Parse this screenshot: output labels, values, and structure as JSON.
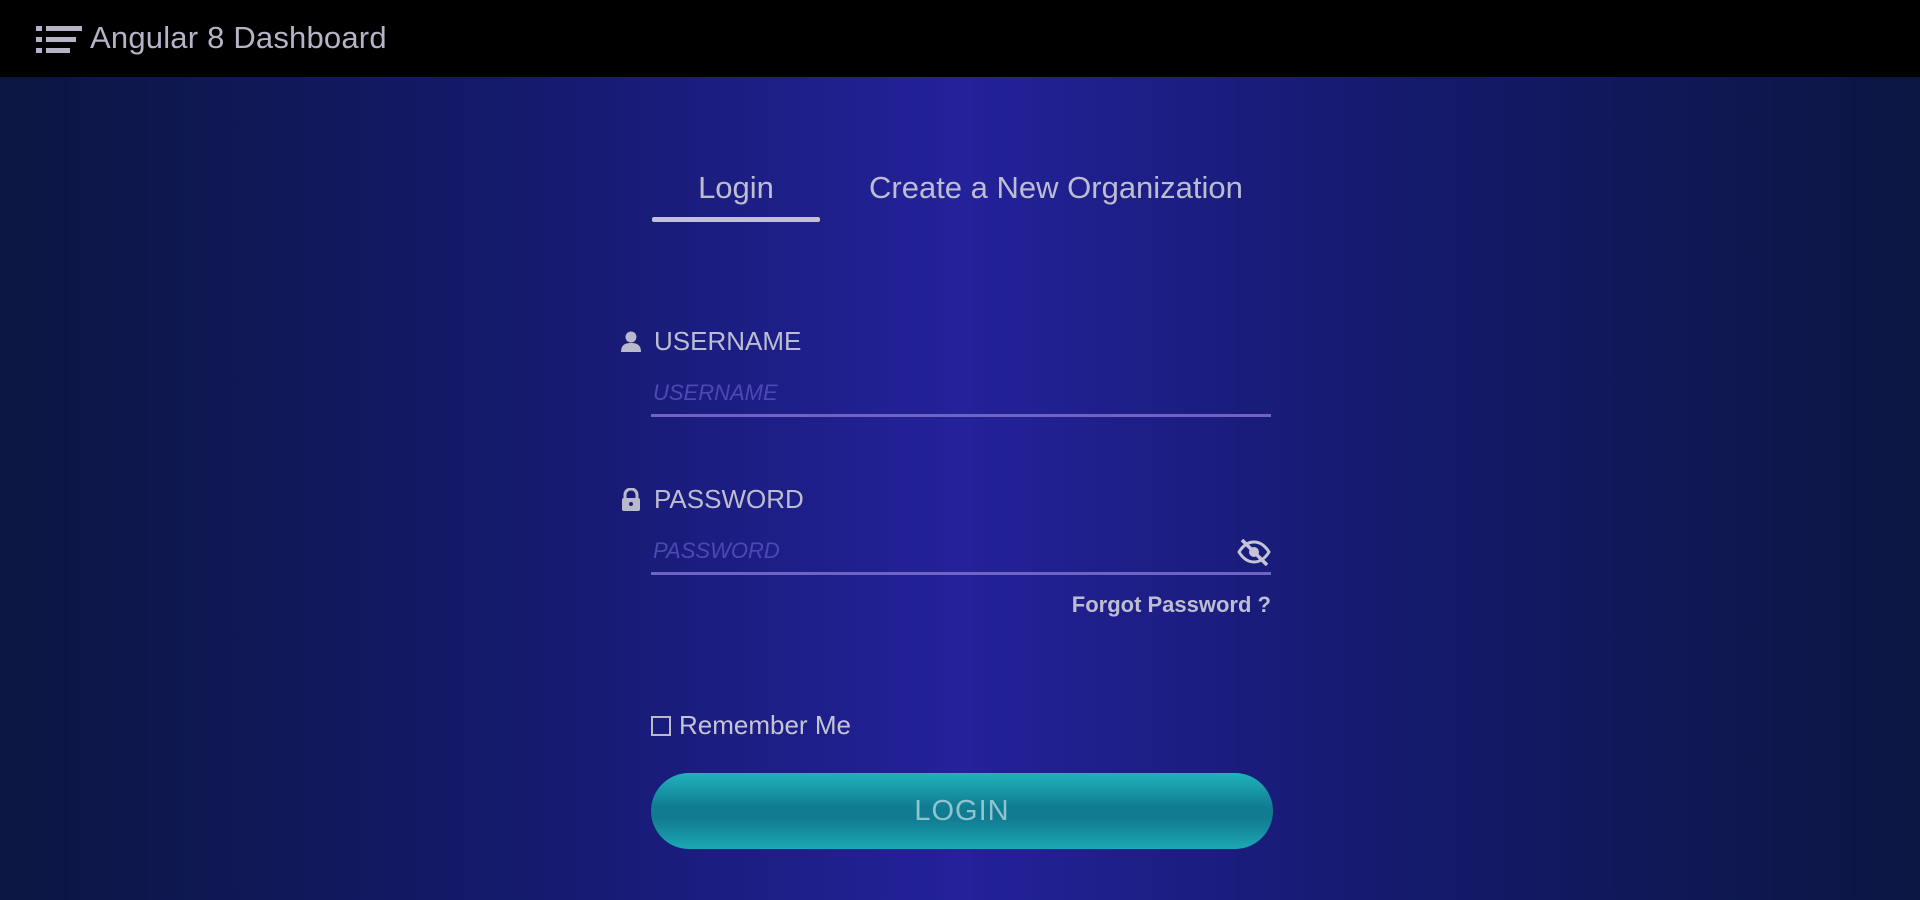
{
  "header": {
    "menu_icon": "hamburger-list-icon",
    "title": "Angular 8 Dashboard"
  },
  "tabs": [
    {
      "label": "Login",
      "active": true
    },
    {
      "label": "Create a New Organization",
      "active": false
    }
  ],
  "form": {
    "username": {
      "icon": "user-icon",
      "label": "USERNAME",
      "placeholder": "USERNAME",
      "value": ""
    },
    "password": {
      "icon": "lock-icon",
      "label": "PASSWORD",
      "placeholder": "PASSWORD",
      "value": "",
      "toggle_icon": "eye-slash-icon"
    },
    "forgot_password": "Forgot Password ?",
    "remember_me": {
      "label": "Remember Me",
      "checked": false
    },
    "submit_label": "LOGIN"
  },
  "colors": {
    "topbar": "#000000",
    "background_center": "#24219a",
    "background_edge": "#0b1641",
    "button": "#117c91",
    "input_underline": "#6d64c6"
  }
}
